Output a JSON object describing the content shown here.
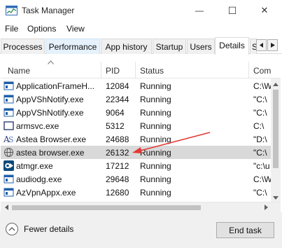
{
  "window": {
    "title": "Task Manager",
    "minimize_glyph": "—",
    "maximize_glyph": "☐",
    "close_glyph": "✕"
  },
  "menu": [
    "File",
    "Options",
    "View"
  ],
  "tabs": [
    {
      "label": "Processes",
      "state": "normal"
    },
    {
      "label": "Performance",
      "state": "hover"
    },
    {
      "label": "App history",
      "state": "normal"
    },
    {
      "label": "Startup",
      "state": "normal"
    },
    {
      "label": "Users",
      "state": "normal"
    },
    {
      "label": "Details",
      "state": "active"
    },
    {
      "label": "S",
      "state": "normal"
    }
  ],
  "table": {
    "columns": [
      "Name",
      "PID",
      "Status",
      "Com"
    ],
    "rows": [
      {
        "name": "ApplicationFrameH...",
        "pid": "12084",
        "status": "Running",
        "cmd": "C:\\W",
        "icon": "app-window-icon"
      },
      {
        "name": "AppVShNotify.exe",
        "pid": "22344",
        "status": "Running",
        "cmd": "\"C:\\",
        "icon": "app-window-icon"
      },
      {
        "name": "AppVShNotify.exe",
        "pid": "9064",
        "status": "Running",
        "cmd": "\"C:\\",
        "icon": "app-window-icon"
      },
      {
        "name": "armsvc.exe",
        "pid": "5312",
        "status": "Running",
        "cmd": "C:\\",
        "icon": "blank-window-icon"
      },
      {
        "name": "Astea Browser.exe",
        "pid": "24688",
        "status": "Running",
        "cmd": "\"D:\\",
        "icon": "astea-logo-icon"
      },
      {
        "name": "astea browser.exe",
        "pid": "26132",
        "status": "Running",
        "cmd": "\"C:\\",
        "icon": "astea-globe-icon",
        "selected": true
      },
      {
        "name": "atmgr.exe",
        "pid": "17212",
        "status": "Running",
        "cmd": "\"c:\\u",
        "icon": "atmgr-icon"
      },
      {
        "name": "audiodg.exe",
        "pid": "29648",
        "status": "Running",
        "cmd": "C:\\W",
        "icon": "app-window-icon"
      },
      {
        "name": "AzVpnAppx.exe",
        "pid": "12680",
        "status": "Running",
        "cmd": "\"C:\\",
        "icon": "app-window-icon"
      }
    ]
  },
  "footer": {
    "fewer_details_label": "Fewer details",
    "end_task_label": "End task"
  },
  "colors": {
    "selected_row": "#d9d9d9",
    "annotation_arrow": "#e53935",
    "hover_tab": "#e5f1fb"
  }
}
